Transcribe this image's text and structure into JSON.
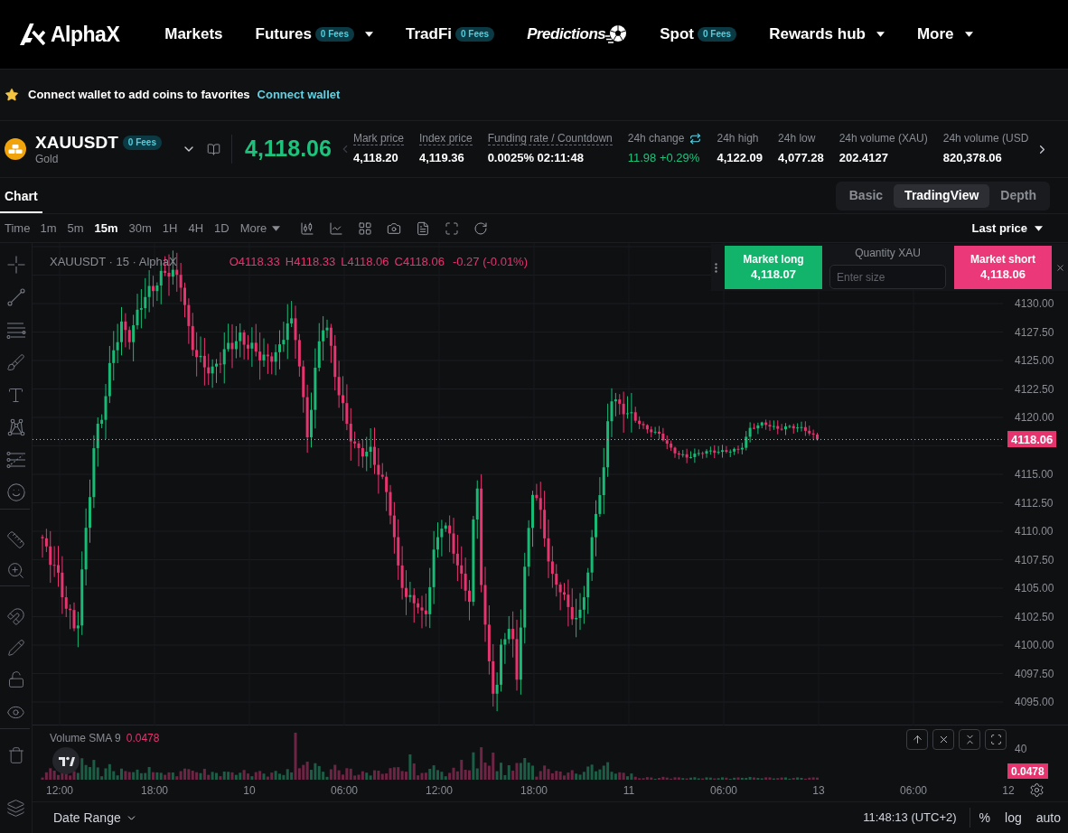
{
  "nav": {
    "logo": "AlphaX",
    "items": [
      {
        "label": "Markets",
        "kind": "link",
        "dropdown": false
      },
      {
        "label": "Futures",
        "kind": "link",
        "badge": "0 Fees",
        "dropdown": true
      },
      {
        "label": "TradFi",
        "kind": "link",
        "badge": "0 Fees",
        "dropdown": false
      },
      {
        "label": "Predictions",
        "kind": "brand",
        "dropdown": false
      },
      {
        "label": "Spot",
        "kind": "link",
        "badge": "0 Fees",
        "dropdown": false
      },
      {
        "label": "Rewards hub",
        "kind": "link",
        "dropdown": true
      },
      {
        "label": "More",
        "kind": "link",
        "dropdown": true
      }
    ]
  },
  "wallet_bar": {
    "message": "Connect wallet to add coins to favorites",
    "link": "Connect wallet"
  },
  "ticker": {
    "symbol": "XAUUSDT",
    "badge": "0 Fees",
    "name": "Gold",
    "price": "4,118.06",
    "stats": [
      {
        "label": "Mark price",
        "value": "4,118.20",
        "kind": "plain",
        "underlined": true
      },
      {
        "label": "Index price",
        "value": "4,119.36",
        "kind": "plain",
        "underlined": true
      },
      {
        "label": "Funding rate / Countdown",
        "value": "0.0025% 02:11:48",
        "kind": "plain",
        "underlined": true
      },
      {
        "label": "24h change",
        "value": "11.98 +0.29%",
        "kind": "change",
        "underlined": false
      },
      {
        "label": "24h high",
        "value": "4,122.09",
        "kind": "plain",
        "underlined": false
      },
      {
        "label": "24h low",
        "value": "4,077.28",
        "kind": "plain",
        "underlined": false
      },
      {
        "label": "24h volume (XAU)",
        "value": "202.4127",
        "kind": "plain",
        "underlined": false
      },
      {
        "label": "24h volume (USD",
        "value": "820,378.06",
        "kind": "plain",
        "underlined": false
      }
    ]
  },
  "chart_header": {
    "tabs": [
      {
        "label": "Chart",
        "selected": true
      }
    ],
    "views": [
      {
        "label": "Basic",
        "selected": false
      },
      {
        "label": "TradingView",
        "selected": true
      },
      {
        "label": "Depth",
        "selected": false
      }
    ]
  },
  "toolbar": {
    "time_label": "Time",
    "intervals": [
      {
        "label": "1m",
        "selected": false
      },
      {
        "label": "5m",
        "selected": false
      },
      {
        "label": "15m",
        "selected": true
      },
      {
        "label": "30m",
        "selected": false
      },
      {
        "label": "1H",
        "selected": false
      },
      {
        "label": "4H",
        "selected": false
      },
      {
        "label": "1D",
        "selected": false
      }
    ],
    "more": "More",
    "price_source": "Last price"
  },
  "chart": {
    "legend": {
      "title": "XAUUSDT · 15 · AlphaX",
      "ohlc": [
        {
          "key": "O",
          "value": "4118.33"
        },
        {
          "key": "H",
          "value": "4118.33"
        },
        {
          "key": "L",
          "value": "4118.06"
        },
        {
          "key": "C",
          "value": "4118.06"
        }
      ],
      "change": "-0.27 (-0.01%)"
    },
    "price_axis": [
      "4130.00",
      "4127.50",
      "4125.00",
      "4122.50",
      "4120.00",
      "4115.00",
      "4112.50",
      "4110.00",
      "4107.50",
      "4105.00",
      "4102.50",
      "4100.00",
      "4097.50",
      "4095.00"
    ],
    "last_price": "4118.06",
    "time_axis": [
      "12:00",
      "18:00",
      "10",
      "06:00",
      "12:00",
      "18:00",
      "11",
      "06:00",
      "13",
      "06:00",
      "12"
    ]
  },
  "trade_panel": {
    "long": {
      "label": "Market long",
      "price": "4,118.07"
    },
    "quantity_label": "Quantity XAU",
    "placeholder": "Enter size",
    "short": {
      "label": "Market short",
      "price": "4,118.06"
    }
  },
  "volume": {
    "label": "Volume SMA 9",
    "value": "0.0478",
    "axis_label": "40",
    "last_value": "0.0478"
  },
  "bottom_bar": {
    "date_range": "Date Range",
    "clock": "11:48:13 (UTC+2)",
    "scale_options": [
      "%",
      "log",
      "auto"
    ]
  }
}
